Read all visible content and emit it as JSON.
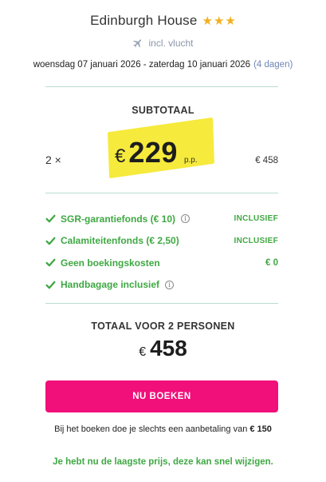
{
  "hotel": {
    "name": "Edinburgh House",
    "stars": 3
  },
  "flight": {
    "label": "incl. vlucht",
    "icon": "airplane-icon"
  },
  "dates": {
    "range": "woensdag 07 januari 2026 - zaterdag 10 januari 2026",
    "days": "(4 dagen)"
  },
  "subtotal": {
    "label": "SUBTOTAAL",
    "quantity": "2 ×",
    "currency": "€",
    "price_per_person": "229",
    "per_person_label": "p.p.",
    "line_total": "€ 458"
  },
  "features": [
    {
      "label": "SGR-garantiefonds  (€ 10)",
      "has_info": true,
      "status": "INCLUSIEF"
    },
    {
      "label": "Calamiteitenfonds  (€ 2,50)",
      "has_info": false,
      "status": "INCLUSIEF"
    },
    {
      "label": "Geen boekingskosten",
      "has_info": false,
      "status": "€ 0"
    },
    {
      "label": "Handbagage inclusief",
      "has_info": true,
      "status": ""
    }
  ],
  "total": {
    "label": "TOTAAL VOOR 2 PERSONEN",
    "currency": "€",
    "amount": "458"
  },
  "book_button": {
    "label": "NU BOEKEN"
  },
  "deposit": {
    "text": "Bij het boeken doe je slechts een aanbetaling van",
    "amount": "€ 150"
  },
  "notice": {
    "text": "Je hebt nu de laagste prijs, deze kan snel wijzigen."
  },
  "colors": {
    "accent_pink": "#f10f7a",
    "success_green": "#3fa843",
    "highlight_yellow": "#f6ea3c",
    "star_gold": "#f2b01e",
    "divider": "#b9dcd3"
  }
}
